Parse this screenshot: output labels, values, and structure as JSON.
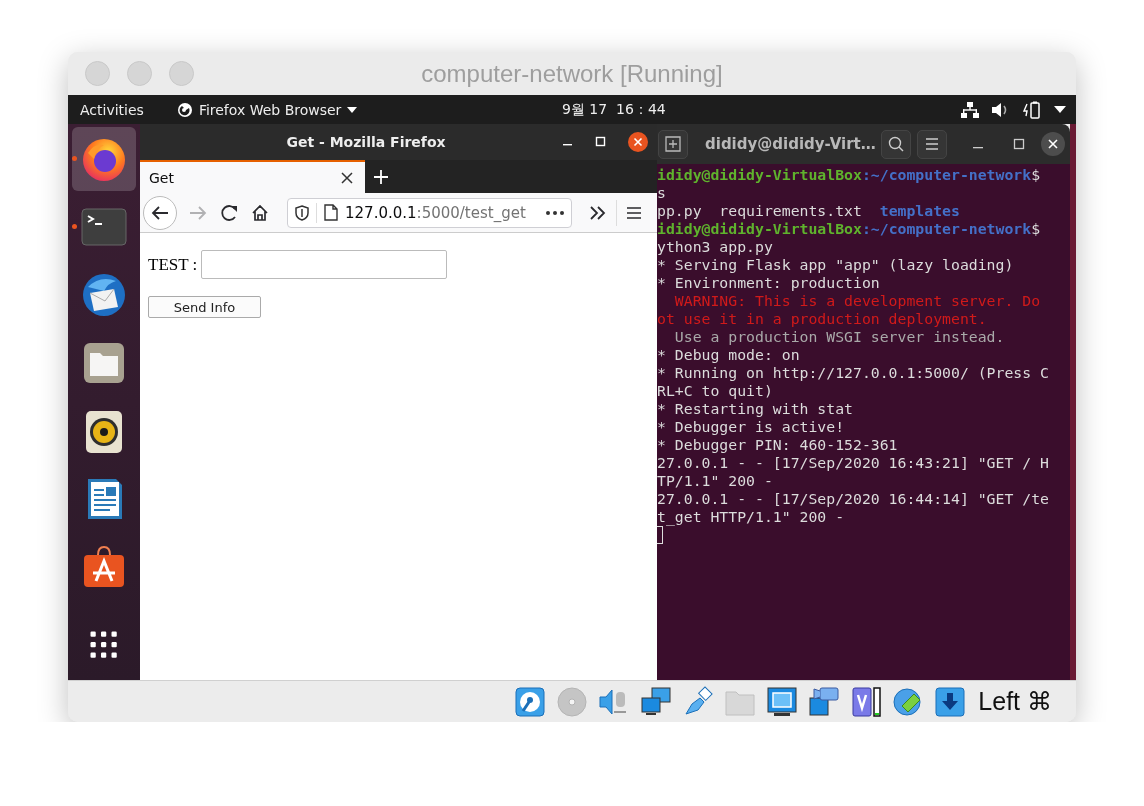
{
  "host_window": {
    "title": "computer-network [Running]"
  },
  "top_bar": {
    "activities": "Activities",
    "app_menu": "Firefox Web Browser",
    "clock": "9월 17  16：44"
  },
  "dock": {
    "items": [
      {
        "kind": "firefox",
        "running": true,
        "active": true
      },
      {
        "kind": "terminal",
        "running": true,
        "active": false
      },
      {
        "kind": "mail",
        "running": false,
        "active": false
      },
      {
        "kind": "files",
        "running": false,
        "active": false
      },
      {
        "kind": "music",
        "running": false,
        "active": false
      },
      {
        "kind": "writer",
        "running": false,
        "active": false
      },
      {
        "kind": "software",
        "running": false,
        "active": false
      },
      {
        "kind": "apps",
        "running": false,
        "active": false
      }
    ]
  },
  "firefox": {
    "title": "Get - Mozilla Firefox",
    "tabs": [
      {
        "label": "Get",
        "selected": true
      }
    ],
    "nav_buttons": [
      {
        "kind": "back",
        "disabled": false
      },
      {
        "kind": "forward",
        "disabled": true
      },
      {
        "kind": "reload",
        "disabled": false
      },
      {
        "kind": "home",
        "disabled": false
      }
    ],
    "url": {
      "host": "127.0.0.1",
      "path": ":5000/test_get"
    },
    "page": {
      "label": "TEST :",
      "button": "Send Info"
    }
  },
  "terminal": {
    "title": "dididy@dididy-Virt…",
    "lines": [
      [
        {
          "kind": "user",
          "text": "ididy@dididy-VirtualBox"
        },
        {
          "kind": "path",
          "text": ":~/computer-network"
        },
        {
          "kind": "plain",
          "text": "$"
        }
      ],
      [
        {
          "kind": "plain",
          "text": "s"
        }
      ],
      [
        {
          "kind": "plain",
          "text": "pp.py  requirements.txt  "
        },
        {
          "kind": "dir",
          "text": "templates"
        }
      ],
      [
        {
          "kind": "user",
          "text": "ididy@dididy-VirtualBox"
        },
        {
          "kind": "path",
          "text": ":~/computer-network"
        },
        {
          "kind": "plain",
          "text": "$"
        }
      ],
      [
        {
          "kind": "plain",
          "text": "ython3 app.py"
        }
      ],
      [
        {
          "kind": "plain",
          "text": "* Serving Flask app \"app\" (lazy loading)"
        }
      ],
      [
        {
          "kind": "plain",
          "text": "* Environment: production"
        }
      ],
      [
        {
          "kind": "error",
          "text": "  WARNING: This is a development server. Do"
        }
      ],
      [
        {
          "kind": "error",
          "text": "ot use it in a production deployment."
        }
      ],
      [
        {
          "kind": "dim",
          "text": "  Use a production WSGI server instead."
        }
      ],
      [
        {
          "kind": "plain",
          "text": "* Debug mode: on"
        }
      ],
      [
        {
          "kind": "plain",
          "text": "* Running on http://127.0.0.1:5000/ (Press C"
        }
      ],
      [
        {
          "kind": "plain",
          "text": "RL+C to quit)"
        }
      ],
      [
        {
          "kind": "plain",
          "text": "* Restarting with stat"
        }
      ],
      [
        {
          "kind": "plain",
          "text": "* Debugger is active!"
        }
      ],
      [
        {
          "kind": "plain",
          "text": "* Debugger PIN: 460-152-361"
        }
      ],
      [
        {
          "kind": "plain",
          "text": "27.0.0.1 - - [17/Sep/2020 16:43:21] \"GET / H"
        }
      ],
      [
        {
          "kind": "plain",
          "text": "TP/1.1\" 200 -"
        }
      ],
      [
        {
          "kind": "plain",
          "text": "27.0.0.1 - - [17/Sep/2020 16:44:14] \"GET /te"
        }
      ],
      [
        {
          "kind": "plain",
          "text": "t_get HTTP/1.1\" 200 -"
        }
      ]
    ]
  },
  "status_bar": {
    "devices": [
      {
        "kind": "hard-disk",
        "disabled": false
      },
      {
        "kind": "optical",
        "disabled": true
      },
      {
        "kind": "audio",
        "disabled": false
      },
      {
        "kind": "network",
        "disabled": false
      },
      {
        "kind": "usb",
        "disabled": false
      },
      {
        "kind": "shared-folder",
        "disabled": true
      },
      {
        "kind": "display",
        "disabled": false
      },
      {
        "kind": "capture",
        "disabled": false
      },
      {
        "kind": "cpu",
        "disabled": false
      },
      {
        "kind": "mouse",
        "disabled": false
      },
      {
        "kind": "download",
        "disabled": false
      }
    ],
    "host_key": "Left ⌘"
  }
}
